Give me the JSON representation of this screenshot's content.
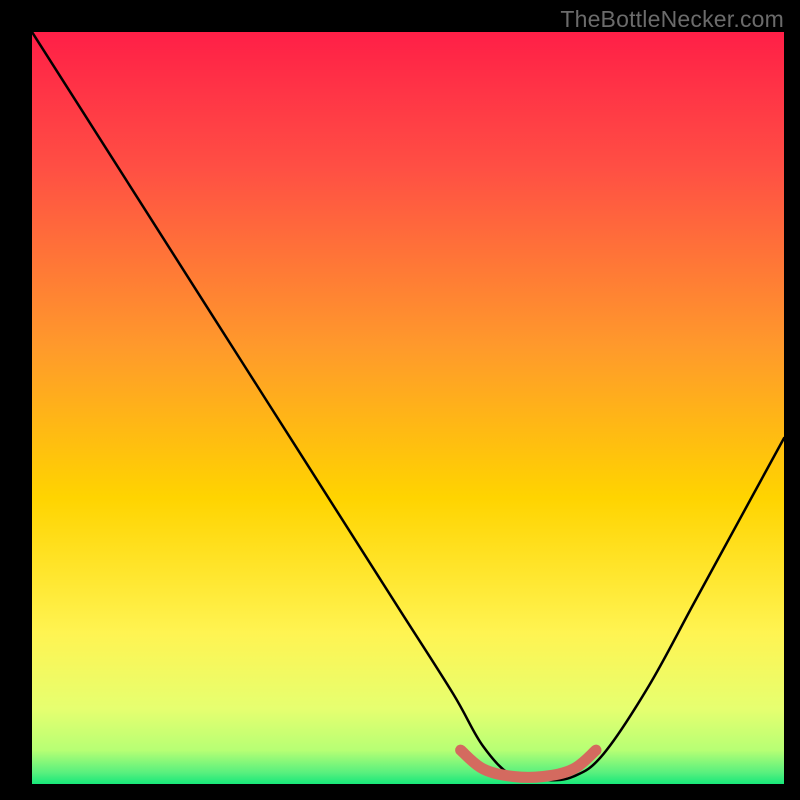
{
  "watermark": "TheBottleNecker.com",
  "chart_data": {
    "type": "line",
    "title": "",
    "xlabel": "",
    "ylabel": "",
    "xlim": [
      0,
      100
    ],
    "ylim": [
      0,
      100
    ],
    "colors": {
      "plot_bg_top": "#ff1f47",
      "plot_bg_mid": "#ffd400",
      "plot_bg_low": "#e9ff70",
      "plot_bg_bottom": "#17e87a",
      "frame": "#000000",
      "curve": "#000000",
      "accent": "#d46a5f"
    },
    "series": [
      {
        "name": "bottleneck-curve",
        "x": [
          0,
          7,
          14,
          21,
          28,
          35,
          42,
          49,
          56,
          60,
          64,
          68,
          72,
          76,
          82,
          88,
          94,
          100
        ],
        "y": [
          100,
          89,
          78,
          67,
          56,
          45,
          34,
          23,
          12,
          5,
          1,
          0.5,
          1,
          4,
          13,
          24,
          35,
          46
        ]
      },
      {
        "name": "sweet-spot",
        "x": [
          57,
          60,
          64,
          68,
          72,
          75
        ],
        "y": [
          4.5,
          2,
          1,
          1,
          2,
          4.5
        ]
      }
    ],
    "annotations": []
  }
}
